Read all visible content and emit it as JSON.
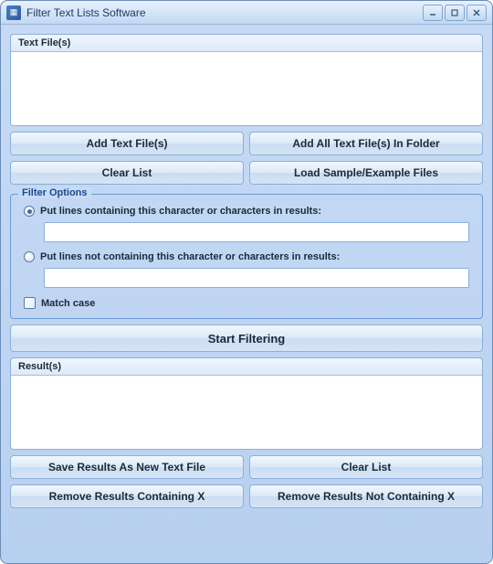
{
  "window": {
    "title": "Filter Text Lists Software"
  },
  "panels": {
    "textfiles_label": "Text File(s)",
    "results_label": "Result(s)"
  },
  "buttons": {
    "add_text_files": "Add Text File(s)",
    "add_all_in_folder": "Add All Text File(s) In Folder",
    "clear_list_top": "Clear List",
    "load_sample": "Load Sample/Example Files",
    "start_filtering": "Start Filtering",
    "save_results": "Save Results As New Text File",
    "clear_list_bottom": "Clear List",
    "remove_containing": "Remove Results Containing X",
    "remove_not_containing": "Remove Results Not Containing X"
  },
  "filter_options": {
    "groupbox_title": "Filter Options",
    "radio_containing": "Put lines containing this character or characters in results:",
    "radio_not_containing": "Put lines not containing this character or characters in results:",
    "match_case": "Match case",
    "input_containing_value": "",
    "input_not_containing_value": ""
  }
}
